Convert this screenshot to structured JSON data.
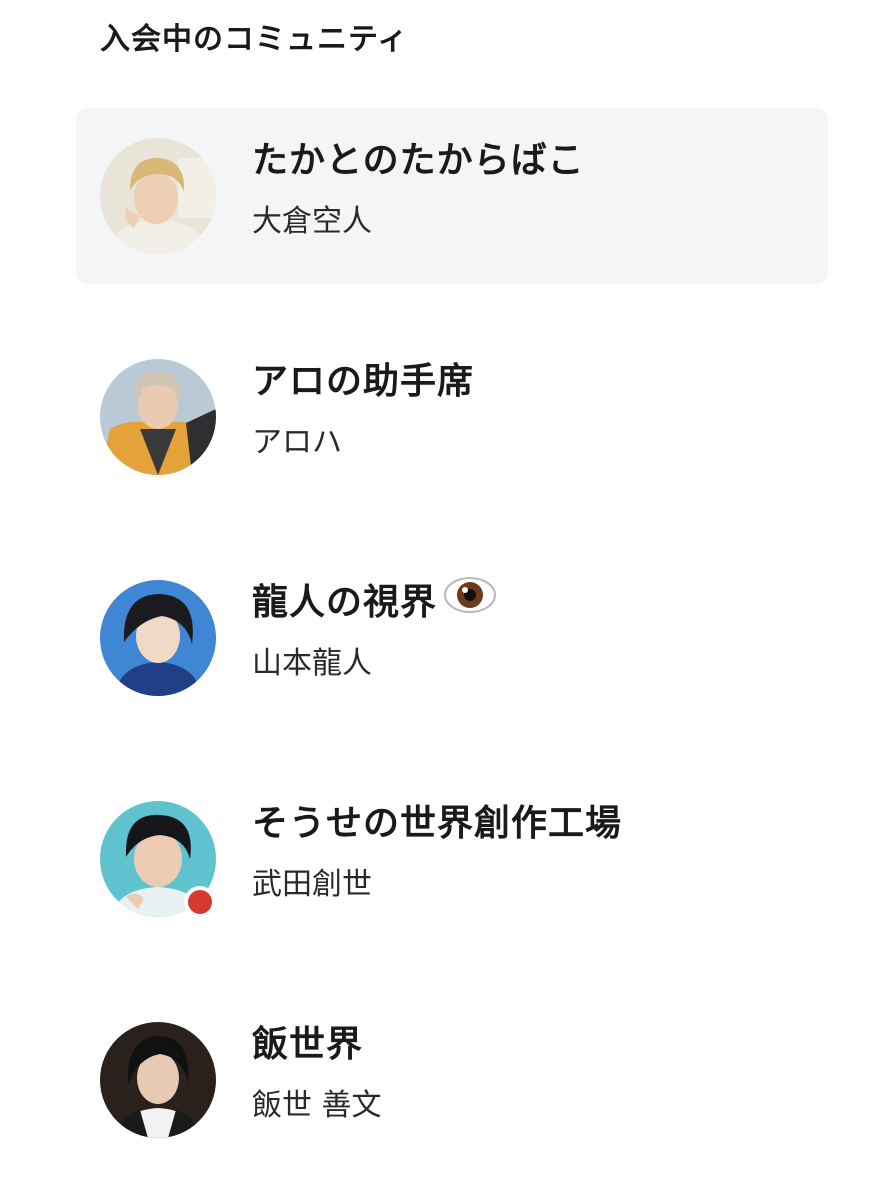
{
  "section_title": "入会中のコミュニティ",
  "communities": [
    {
      "name": "たかとのたからばこ",
      "owner": "大倉空人",
      "selected": true,
      "live": false
    },
    {
      "name": "アロの助手席",
      "owner": "アロハ",
      "selected": false,
      "live": false
    },
    {
      "name": "龍人の視界",
      "owner": "山本龍人",
      "selected": false,
      "live": false,
      "emoji": "eye-emoji"
    },
    {
      "name": "そうせの世界創作工場",
      "owner": "武田創世",
      "selected": false,
      "live": true
    },
    {
      "name": "飯世界",
      "owner": "飯世 善文",
      "selected": false,
      "live": false
    }
  ],
  "colors": {
    "selected_bg": "#f4f5f7",
    "live_dot": "#d63a2f",
    "text": "#1a1a1a"
  }
}
